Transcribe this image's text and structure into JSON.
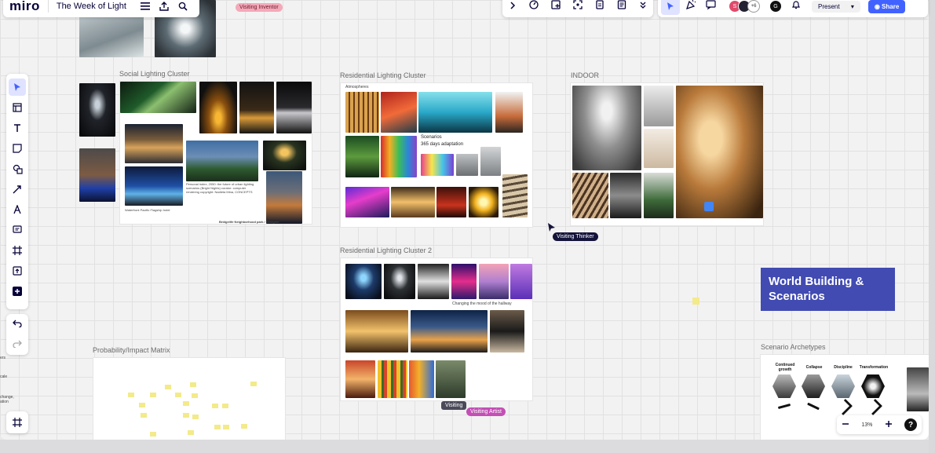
{
  "app": {
    "logo": "miro",
    "board_title": "The Week of Light"
  },
  "top_toolbar": {
    "icons": [
      "chevron-right-icon",
      "timer-icon",
      "sticky-add-icon",
      "focus-icon",
      "doc-icon",
      "notes-icon",
      "more-icon"
    ]
  },
  "collab": {
    "avatars": [
      {
        "initial": "S",
        "color": "#e04a6b"
      },
      {
        "initial": "",
        "color": "#222233"
      },
      {
        "initial": "+6",
        "color": "#ffffff"
      },
      {
        "initial": "G",
        "color": "#111111"
      }
    ],
    "notification_count": "1",
    "present_label": "Present",
    "share_label": "Share"
  },
  "cursors": {
    "inventor": "Visiting Inventor",
    "thinker": "Visiting Thinker",
    "artist": "Visiting Artist",
    "visiting": "Visiting"
  },
  "frames": {
    "social": {
      "title": "Social Lighting Cluster",
      "caption_1": "Personal index, 2050: the future of urban lighting scenarios (Bright Nights) curator: computer rendering copyright: Nadieta Mina, CONCEPTS",
      "caption_2": "Bridgelife Neighborhood park / Designer",
      "caption_3": "Waterfront Pacific Flagship hotel"
    },
    "residential": {
      "title": "Residential Lighting Cluster",
      "atmosphere": "Atmospheres",
      "scenarios": "Scenarios",
      "scenarios_sub": "365 days adaptation"
    },
    "residential2": {
      "title": "Residential Lighting Cluster 2",
      "caption_1": "Changing the mood of the hallway"
    },
    "indoor": {
      "title": "INDOOR"
    },
    "matrix": {
      "title": "Probability/Impact Matrix"
    },
    "archetypes": {
      "title": "Scenario Archetypes",
      "items": [
        "Continued growth",
        "Collapse",
        "Discipline",
        "Transformation"
      ]
    }
  },
  "world_building": "World Building & Scenarios",
  "zoom": {
    "level": "13%"
  },
  "side_cut_texts": [
    "ers",
    "cale",
    "change,",
    "ation"
  ],
  "colors": {
    "accent": "#4262ff",
    "wb_box": "#414bb2",
    "artist_tag": "#c34fb5",
    "inventor_tag": "#f4a9b8",
    "thinker_tag": "#14133a"
  }
}
